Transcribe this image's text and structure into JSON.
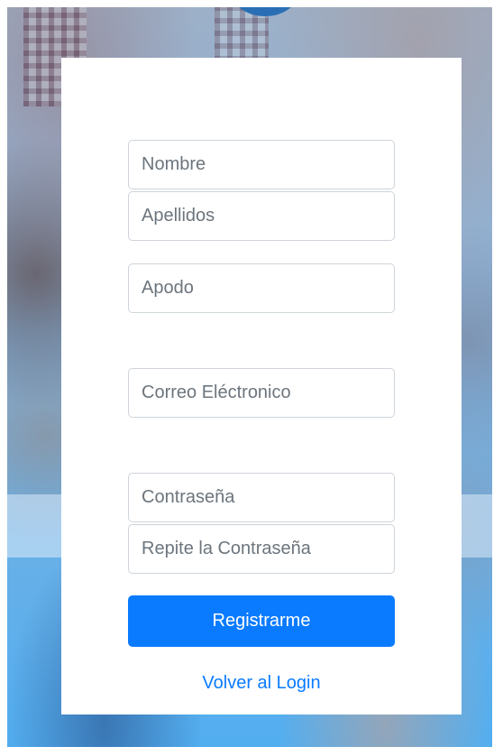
{
  "form": {
    "nombre_placeholder": "Nombre",
    "apellidos_placeholder": "Apellidos",
    "apodo_placeholder": "Apodo",
    "correo_placeholder": "Correo Eléctronico",
    "contrasena_placeholder": "Contraseña",
    "repite_contrasena_placeholder": "Repite la Contraseña",
    "submit_label": "Registrarme",
    "back_link_label": "Volver al Login"
  },
  "colors": {
    "primary": "#0a7bff",
    "input_border": "#ced4da",
    "card_background": "#ffffff"
  }
}
